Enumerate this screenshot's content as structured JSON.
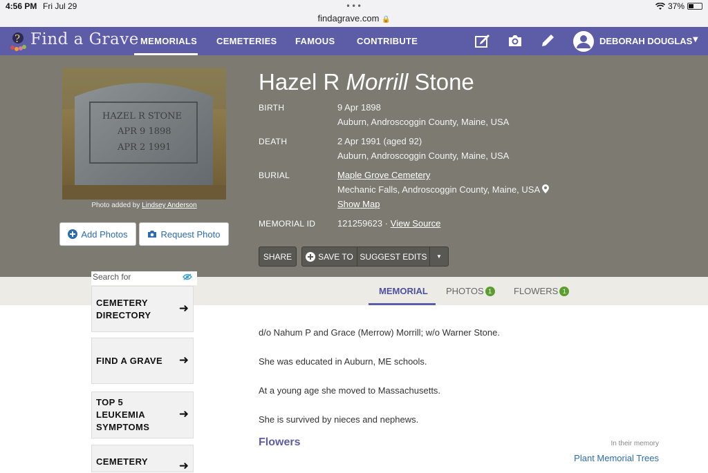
{
  "status": {
    "time": "4:56 PM",
    "date": "Fri Jul 29",
    "url": "findagrave.com",
    "battery": "37%"
  },
  "nav": {
    "logo": "Find a Grave",
    "items": [
      "MEMORIALS",
      "CEMETERIES",
      "FAMOUS",
      "CONTRIBUTE"
    ],
    "user": "DEBORAH DOUGLAS"
  },
  "memorial": {
    "name_first": "Hazel R",
    "name_maiden": "Morrill",
    "name_last": "Stone",
    "birth_label": "BIRTH",
    "birth_date": "9 Apr 1898",
    "birth_place": "Auburn, Androscoggin County, Maine, USA",
    "death_label": "DEATH",
    "death_date": "2 Apr 1991 (aged 92)",
    "death_place": "Auburn, Androscoggin County, Maine, USA",
    "burial_label": "BURIAL",
    "burial_cemetery": "Maple Grove Cemetery",
    "burial_place": "Mechanic Falls, Androscoggin County, Maine, USA",
    "show_map": "Show Map",
    "id_label": "MEMORIAL ID",
    "id_value": "121259623 ·",
    "view_source": "View Source"
  },
  "photo": {
    "caption_prefix": "Photo added by",
    "caption_author": "Lindsey Anderson",
    "add_photos": "Add Photos",
    "request_photo": "Request Photo",
    "stone_text": [
      "HAZEL R STONE",
      "APR 9 1898",
      "APR 2 1991"
    ]
  },
  "actions": {
    "share": "SHARE",
    "save_to": "SAVE TO",
    "suggest_edits": "SUGGEST EDITS"
  },
  "tabs": {
    "memorial": "MEMORIAL",
    "photos": "PHOTOS",
    "photos_count": "1",
    "flowers": "FLOWERS",
    "flowers_count": "1"
  },
  "sidebar": {
    "search_label": "Search for",
    "cards": [
      {
        "line1": "CEMETERY",
        "line2": "DIRECTORY",
        "line3": ""
      },
      {
        "line1": "FIND A GRAVE",
        "line2": "",
        "line3": ""
      },
      {
        "line1": "TOP 5",
        "line2": "LEUKEMIA",
        "line3": "SYMPTOMS"
      },
      {
        "line1": "CEMETERY",
        "line2": "",
        "line3": ""
      }
    ]
  },
  "bio": [
    "d/o Nahum P and Grace (Merrow) Morrill; w/o Warner Stone.",
    "She was educated in Auburn, ME schools.",
    "At a young age she moved to Massachusetts.",
    "She is survived by nieces and nephews."
  ],
  "flowers": {
    "heading": "Flowers",
    "memory_label": "In their memory",
    "plant_link": "Plant Memorial Trees"
  }
}
